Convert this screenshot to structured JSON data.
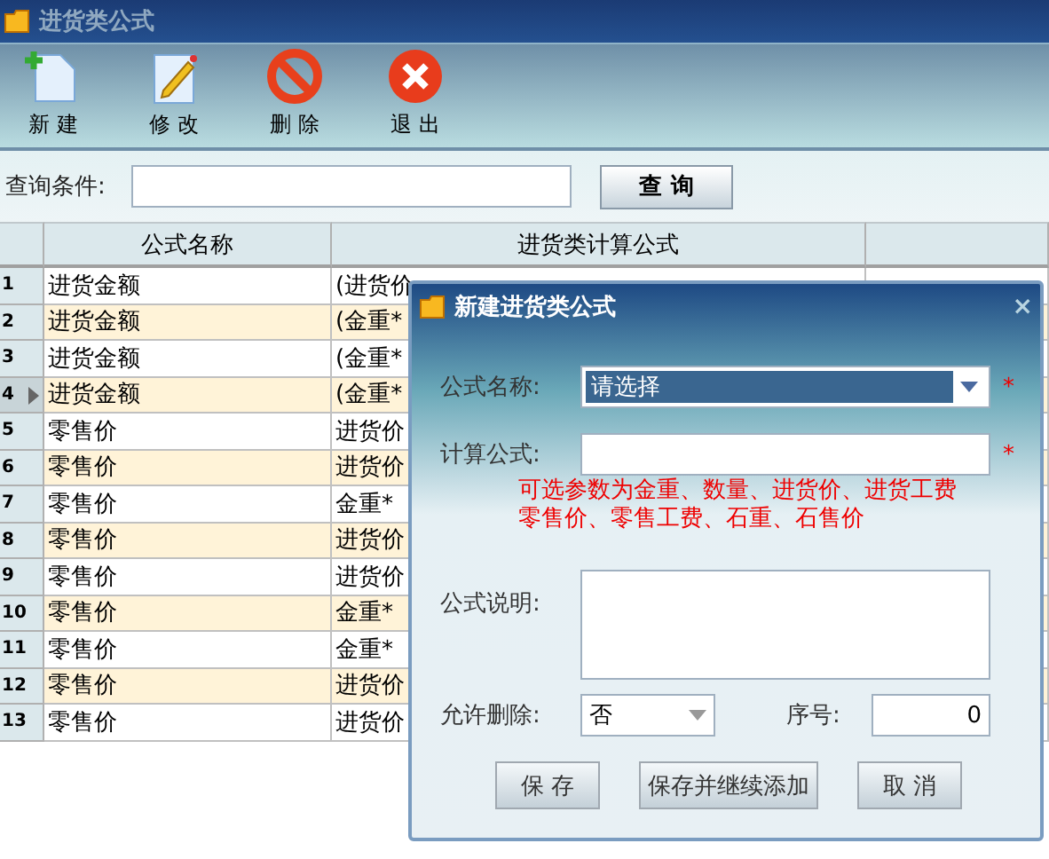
{
  "window": {
    "title": "进货类公式"
  },
  "toolbar": [
    {
      "kind": "new",
      "label": "新 建"
    },
    {
      "kind": "edit",
      "label": "修 改"
    },
    {
      "kind": "delete",
      "label": "删 除"
    },
    {
      "kind": "exit",
      "label": "退 出"
    }
  ],
  "query": {
    "label": "查询条件:",
    "button": "查 询"
  },
  "table": {
    "columns": [
      "公式名称",
      "进货类计算公式"
    ],
    "rows": [
      {
        "number": "1",
        "name": "进货金额",
        "formula": "(进货价",
        "current": false
      },
      {
        "number": "2",
        "name": "进货金额",
        "formula": "(金重*",
        "current": false
      },
      {
        "number": "3",
        "name": "进货金额",
        "formula": "(金重*",
        "current": false
      },
      {
        "number": "4",
        "name": "进货金额",
        "formula": "(金重*",
        "current": true
      },
      {
        "number": "5",
        "name": "零售价",
        "formula": "进货价",
        "current": false
      },
      {
        "number": "6",
        "name": "零售价",
        "formula": "进货价",
        "current": false
      },
      {
        "number": "7",
        "name": "零售价",
        "formula": "金重*",
        "current": false
      },
      {
        "number": "8",
        "name": "零售价",
        "formula": "进货价",
        "current": false
      },
      {
        "number": "9",
        "name": "零售价",
        "formula": "进货价",
        "current": false
      },
      {
        "number": "10",
        "name": "零售价",
        "formula": "金重*",
        "current": false
      },
      {
        "number": "11",
        "name": "零售价",
        "formula": "金重*",
        "current": false
      },
      {
        "number": "12",
        "name": "零售价",
        "formula": "进货价",
        "current": false
      },
      {
        "number": "13",
        "name": "零售价",
        "formula": "进货价",
        "current": false
      }
    ]
  },
  "dialog": {
    "title": "新建进货类公式",
    "close": "×",
    "name_label": "公式名称:",
    "name_value": "请选择",
    "required_mark": "*",
    "formula_label": "计算公式:",
    "hint": [
      "可选参数为金重、数量、进货价、进货工费",
      "零售价、零售工费、石重、石售价"
    ],
    "description_label": "公式说明:",
    "allow_delete_label": "允许删除:",
    "allow_delete_value": "否",
    "sequence_label": "序号:",
    "sequence_value": "0",
    "buttons": [
      "保 存",
      "保存并继续添加",
      "取 消"
    ]
  }
}
